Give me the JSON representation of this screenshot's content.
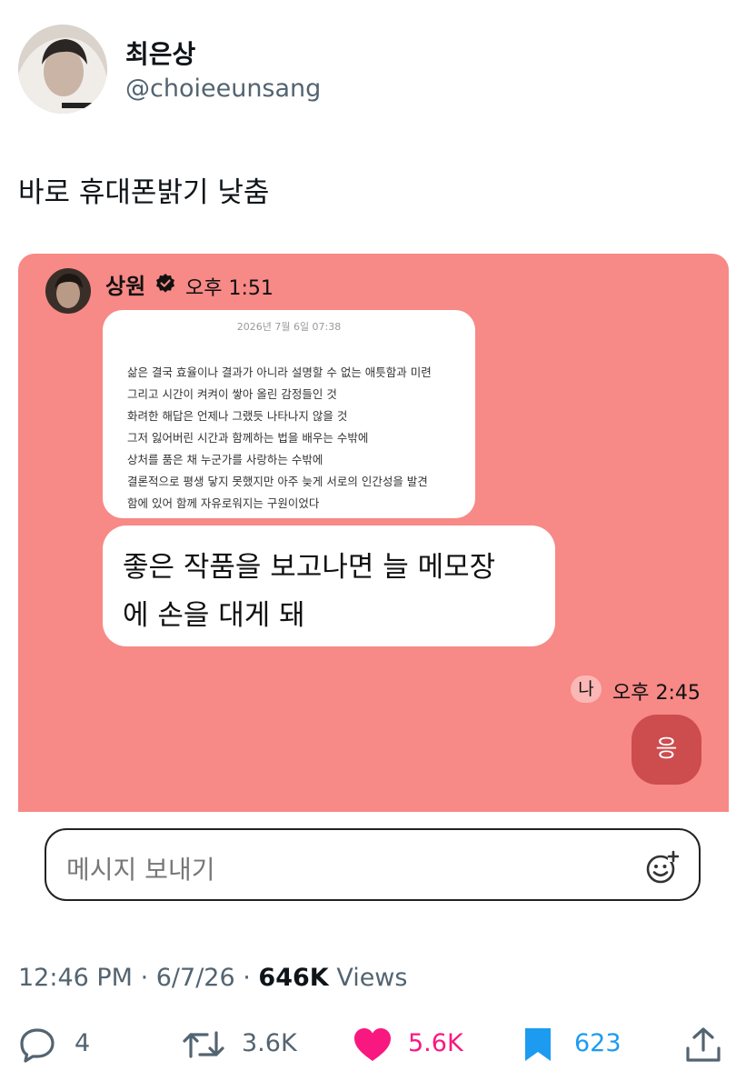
{
  "author": {
    "display_name": "최은상",
    "handle": "@choieeunsang"
  },
  "tweet": {
    "text": "바로 휴대폰밝기 낮춤"
  },
  "chat": {
    "sender_name": "상원",
    "sender_time": "오후 1:51",
    "memo": {
      "date": "2026년 7월 6일 07:38",
      "lines": [
        "삶은 결국 효율이나 결과가 아니라 설명할 수 없는 애틋함과 미련",
        "그리고 시간이 켜켜이 쌓아 올린 감정들인 것",
        "화려한 해답은 언제나 그랬듯 나타나지 않을 것",
        "그저 잃어버린 시간과 함께하는 법을 배우는 수밖에",
        "상처를 품은 채 누군가를 사랑하는 수밖에",
        "결론적으로 평생 닿지 못했지만 아주 늦게 서로의 인간성을 발견",
        "함에 있어 함께 자유로워지는 구원이었다"
      ]
    },
    "message_lines": [
      "좋은 작품을 보고나면 늘 메모장",
      "에 손을 대게 돼"
    ],
    "me_label": "나",
    "me_time": "오후 2:45",
    "reply": "응",
    "input_placeholder": "메시지 보내기",
    "colors": {
      "background": "#f78986",
      "reply_bubble": "#cd4c4e"
    }
  },
  "meta": {
    "time": "12:46 PM",
    "date": "6/7/26",
    "views_count": "646K",
    "views_label": "Views"
  },
  "actions": {
    "replies": "4",
    "reposts": "3.6K",
    "likes": "5.6K",
    "bookmarks": "623"
  }
}
